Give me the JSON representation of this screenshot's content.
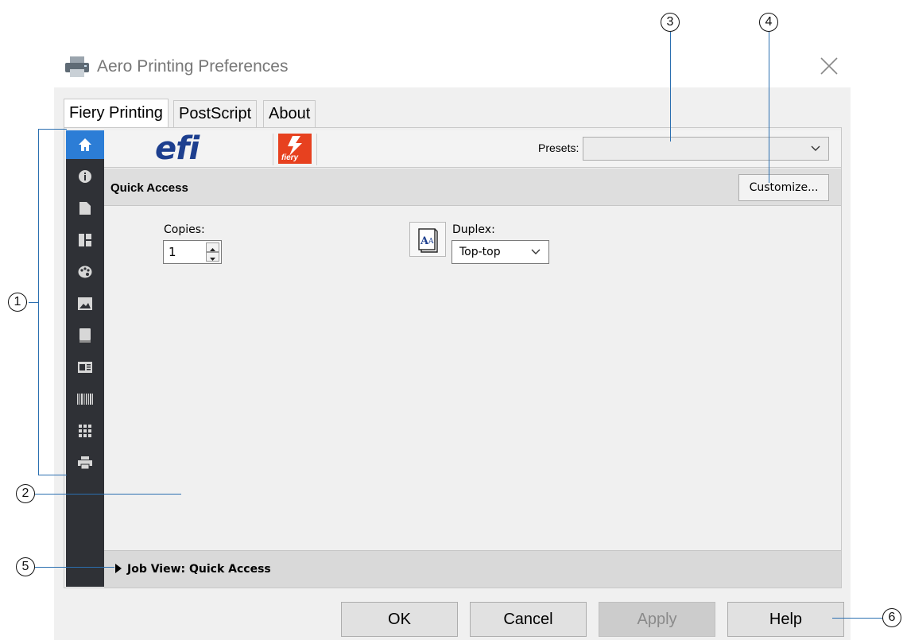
{
  "window": {
    "title": "Aero Printing Preferences",
    "icon": "printer-icon",
    "close": "close-icon"
  },
  "tabs": [
    {
      "label": "Fiery Printing",
      "active": true
    },
    {
      "label": "PostScript",
      "active": false
    },
    {
      "label": "About",
      "active": false
    }
  ],
  "nav": [
    {
      "icon": "home-icon",
      "active": true
    },
    {
      "icon": "info-icon"
    },
    {
      "icon": "document-icon"
    },
    {
      "icon": "layout-icon"
    },
    {
      "icon": "palette-icon"
    },
    {
      "icon": "image-icon"
    },
    {
      "icon": "book-icon"
    },
    {
      "icon": "stamp-icon"
    },
    {
      "icon": "barcode-icon"
    },
    {
      "icon": "grid-icon"
    },
    {
      "icon": "printer-icon"
    }
  ],
  "header": {
    "logo_text": "efi",
    "fiery_logo_text": "fiery",
    "presets_label": "Presets:",
    "presets_value": ""
  },
  "quick_access": {
    "title": "Quick Access",
    "customize_label": "Customize...",
    "copies_label": "Copies:",
    "copies_value": "1",
    "duplex_label": "Duplex:",
    "duplex_value": "Top-top"
  },
  "job_view": {
    "label": "Job View: Quick Access"
  },
  "buttons": {
    "ok": "OK",
    "cancel": "Cancel",
    "apply": "Apply",
    "help": "Help"
  },
  "callouts": [
    "1",
    "2",
    "3",
    "4",
    "5",
    "6"
  ],
  "colors": {
    "nav_bg": "#2f3136",
    "nav_active": "#2c7dd6",
    "fiery_red": "#e7411f",
    "efi_blue": "#1d3f8f",
    "callout_line": "#2b6fb0"
  }
}
